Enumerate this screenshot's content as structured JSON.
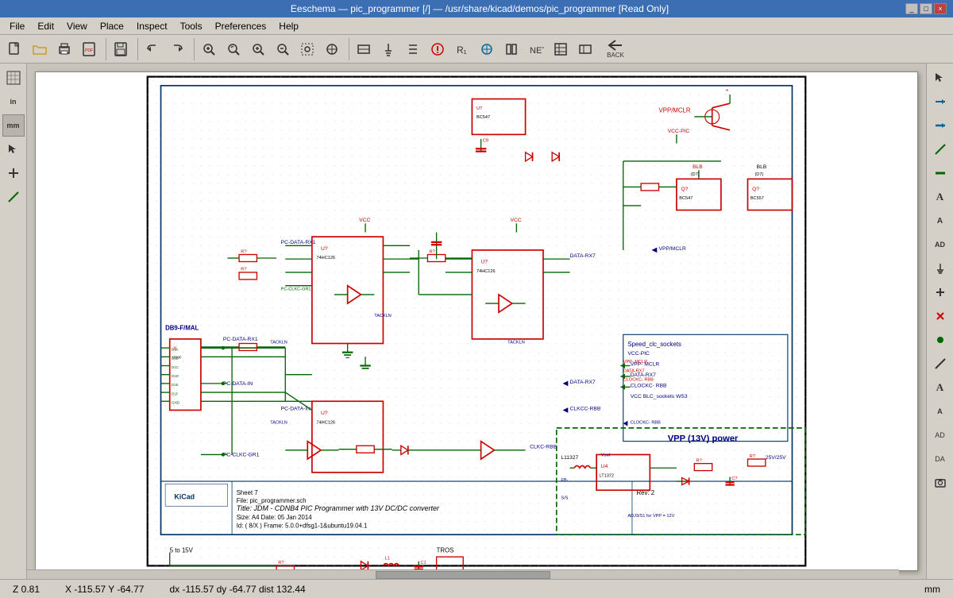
{
  "titlebar": {
    "text": "Eeschema — pic_programmer [/] — /usr/share/kicad/demos/pic_programmer [Read Only]",
    "controls": [
      "_",
      "□",
      "×"
    ]
  },
  "menubar": {
    "items": [
      "File",
      "Edit",
      "View",
      "Place",
      "Inspect",
      "Tools",
      "Preferences",
      "Help"
    ]
  },
  "toolbar": {
    "buttons": [
      {
        "name": "new",
        "icon": "📄"
      },
      {
        "name": "open",
        "icon": "📂"
      },
      {
        "name": "print",
        "icon": "🖨"
      },
      {
        "name": "save-pdf",
        "icon": "📑"
      },
      {
        "name": "save",
        "icon": "💾"
      },
      {
        "name": "undo",
        "icon": "↩"
      },
      {
        "name": "redo",
        "icon": "↪"
      },
      {
        "name": "zoom-fit",
        "icon": "🔍"
      },
      {
        "name": "zoom-refresh",
        "icon": "🔄"
      },
      {
        "name": "zoom-in",
        "icon": "+"
      },
      {
        "name": "zoom-out",
        "icon": "−"
      },
      {
        "name": "zoom-area",
        "icon": "⊞"
      },
      {
        "name": "zoom-center",
        "icon": "⊕"
      }
    ]
  },
  "left_toolbar": {
    "buttons": [
      {
        "name": "grid",
        "icon": "⊞"
      },
      {
        "name": "unit",
        "icon": "in"
      },
      {
        "name": "unit-mm",
        "icon": "mm"
      },
      {
        "name": "cursor",
        "icon": "↖"
      },
      {
        "name": "add-symbol",
        "icon": "+"
      },
      {
        "name": "add-wire",
        "icon": "╱"
      }
    ]
  },
  "right_toolbar": {
    "buttons": [
      {
        "name": "select",
        "icon": "↖"
      },
      {
        "name": "highlight",
        "icon": "→"
      },
      {
        "name": "net-highlight",
        "icon": "⇒"
      },
      {
        "name": "draw-wire",
        "icon": "╱"
      },
      {
        "name": "draw-bus",
        "icon": "═"
      },
      {
        "name": "add-label",
        "icon": "A"
      },
      {
        "name": "add-global-label",
        "icon": "A"
      },
      {
        "name": "add-hier-label",
        "icon": "AD"
      },
      {
        "name": "add-power",
        "icon": "AD"
      },
      {
        "name": "add-symbol-r",
        "icon": "×"
      },
      {
        "name": "add-no-connect",
        "icon": "×"
      },
      {
        "name": "add-junction",
        "icon": "●"
      },
      {
        "name": "add-line",
        "icon": "╱"
      },
      {
        "name": "add-text",
        "icon": "A"
      },
      {
        "name": "add-text-box",
        "icon": "A"
      },
      {
        "name": "delete-btn",
        "icon": "AD"
      },
      {
        "name": "delete2",
        "icon": "DA"
      },
      {
        "name": "screenshot",
        "icon": "📷"
      }
    ]
  },
  "statusbar": {
    "zoom": "Z 0.81",
    "coords": "X -115.57  Y -64.77",
    "delta": "dx -115.57  dy -64.77  dist 132.44",
    "unit": "mm"
  }
}
